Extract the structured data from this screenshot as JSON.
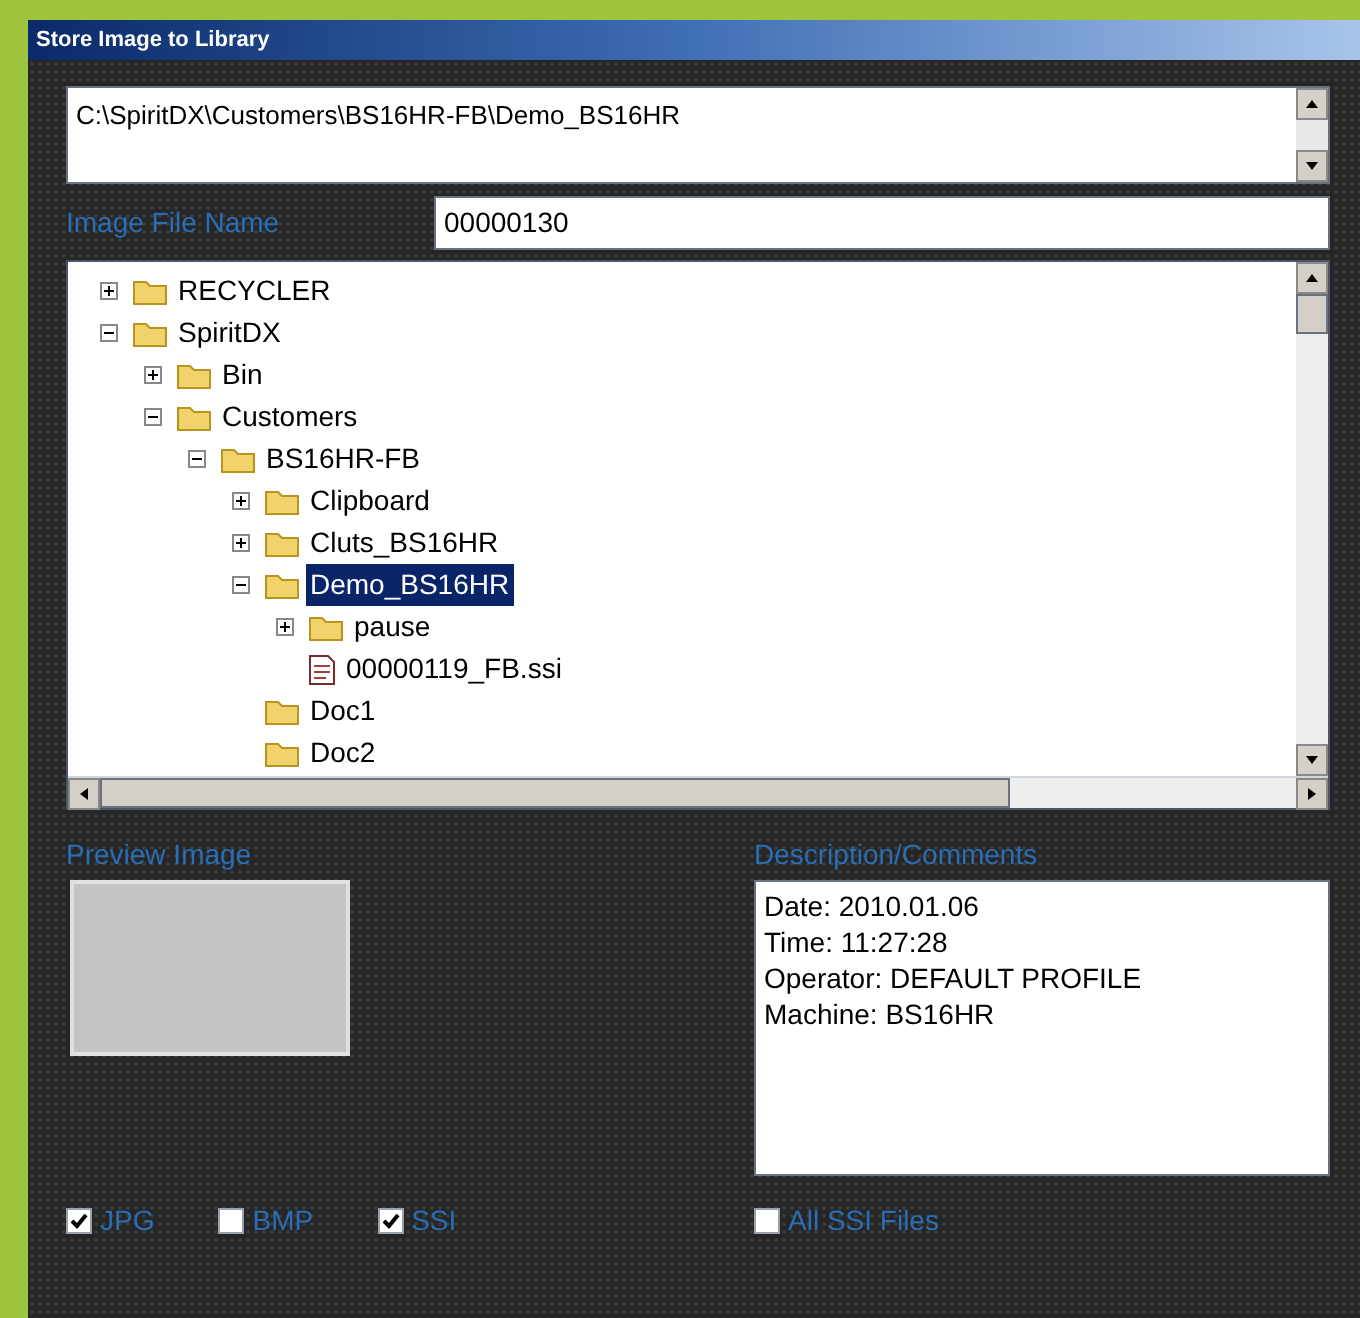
{
  "window": {
    "title": "Store Image to Library"
  },
  "path": {
    "value": "C:\\SpiritDX\\Customers\\BS16HR-FB\\Demo_BS16HR"
  },
  "image_file_name": {
    "label": "Image File Name",
    "value": "00000130"
  },
  "tree": [
    {
      "label": "RECYCLER",
      "kind": "folder",
      "expanded": false,
      "selected": false
    },
    {
      "label": "SpiritDX",
      "kind": "folder",
      "expanded": true,
      "selected": false,
      "children": [
        {
          "label": "Bin",
          "kind": "folder",
          "expanded": false,
          "selected": false
        },
        {
          "label": "Customers",
          "kind": "folder",
          "expanded": true,
          "selected": false,
          "children": [
            {
              "label": "BS16HR-FB",
              "kind": "folder",
              "expanded": true,
              "selected": false,
              "children": [
                {
                  "label": "Clipboard",
                  "kind": "folder",
                  "expanded": false,
                  "selected": false
                },
                {
                  "label": "Cluts_BS16HR",
                  "kind": "folder",
                  "expanded": false,
                  "selected": false
                },
                {
                  "label": "Demo_BS16HR",
                  "kind": "folder",
                  "expanded": true,
                  "selected": true,
                  "children": [
                    {
                      "label": "pause",
                      "kind": "folder",
                      "expanded": false,
                      "selected": false
                    },
                    {
                      "label": "00000119_FB.ssi",
                      "kind": "file",
                      "selected": false
                    }
                  ]
                },
                {
                  "label": "Doc1",
                  "kind": "folder",
                  "selected": false
                },
                {
                  "label": "Doc2",
                  "kind": "folder",
                  "selected": false
                }
              ]
            }
          ]
        }
      ]
    }
  ],
  "preview": {
    "label": "Preview Image"
  },
  "description": {
    "label": "Description/Comments",
    "lines": [
      "Date: 2010.01.06",
      "Time: 11:27:28",
      "Operator: DEFAULT PROFILE",
      "Machine: BS16HR"
    ]
  },
  "file_types": [
    {
      "label": "JPG",
      "checked": true
    },
    {
      "label": "BMP",
      "checked": false
    },
    {
      "label": "SSI",
      "checked": true
    }
  ],
  "all_files": {
    "label": "All SSI Files",
    "checked": false
  }
}
